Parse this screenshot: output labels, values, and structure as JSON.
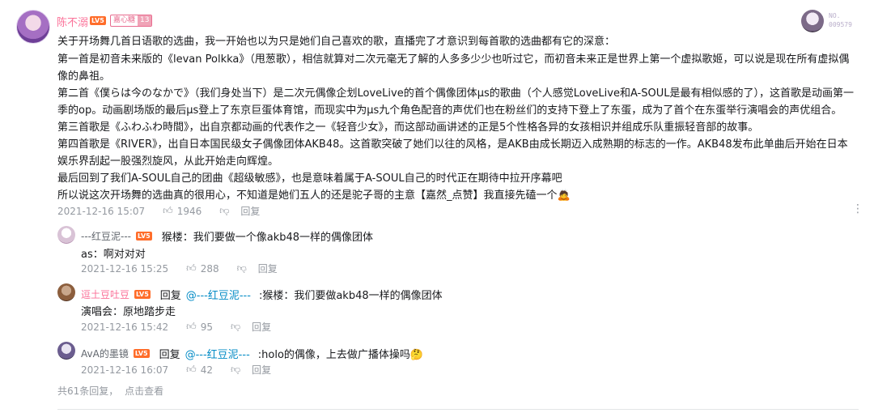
{
  "comment": {
    "username": "陈不溺",
    "level": "LV5",
    "medal_name": "嘉心糖",
    "medal_level": "13",
    "deco_label": "NO.",
    "deco_number": "009579",
    "lines": [
      "关于开场舞几首日语歌的选曲，我一开始也以为只是她们自己喜欢的歌，直播完了才意识到每首歌的选曲都有它的深意：",
      "第一首是初音未来版的《levan Polkka》（甩葱歌），相信就算对二次元毫无了解的人多多少少也听过它，而初音未来正是世界上第一个虚拟歌姬，可以说是现在所有虚拟偶",
      "像的鼻祖。",
      "第二首《僕らは今のなかで》（我们身处当下）是二次元偶像企划LoveLive的首个偶像团体μs的歌曲（个人感觉LoveLive和A-SOUL是最有相似感的了），这首歌是动画第一",
      "季的op。动画剧场版的最后μs登上了东京巨蛋体育馆，而现实中为μs九个角色配音的声优们也在粉丝们的支持下登上了东蛋，成为了首个在东蛋举行演唱会的声优组合。",
      "第三首歌是《ふわふわ時間》，出自京都动画的代表作之一《轻音少女》，而这部动画讲述的正是5个性格各异的女孩相识并组成乐队重振轻音部的故事。",
      "第四首歌是《RIVER》，出自日本国民级女子偶像团体AKB48。这首歌突破了她们以往的风格，是AKB由成长期迈入成熟期的标志的一作。AKB48发布此单曲后开始在日本",
      "娱乐界刮起一股强烈旋风，从此开始走向辉煌。",
      "最后回到了我们A-SOUL自己的团曲《超级敏感》，也是意味着属于A-SOUL自己的时代正在期待中拉开序幕吧",
      "所以说这次开场舞的选曲真的很用心，不知道是她们五人的还是驼子哥的主意【嘉然_点赞】我直接先磕一个🙇"
    ],
    "time": "2021-12-16 15:07",
    "likes": "1946",
    "reply_label": "回复"
  },
  "replies": [
    {
      "username": "---红豆泥---",
      "level": "LV5",
      "prefix": "",
      "mention": "",
      "text1": "猴楼：我们要做一个像akb48一样的偶像团体",
      "text2": "as：啊对对对",
      "time": "2021-12-16 15:25",
      "likes": "288",
      "reply_label": "回复",
      "name_color": "#61666d"
    },
    {
      "username": "逗土豆吐豆",
      "level": "LV5",
      "prefix": "回复",
      "mention": "@---红豆泥---",
      "text1": ":猴楼：我们要做akb48一样的偶像团体",
      "text2": "演唱会：原地踏步走",
      "time": "2021-12-16 15:42",
      "likes": "95",
      "reply_label": "回复",
      "name_color": "#fb7299"
    },
    {
      "username": "AvA的墨镜",
      "level": "LV5",
      "prefix": "回复",
      "mention": "@---红豆泥---",
      "text1": ":holo的偶像，上去做广播体操吗🤔",
      "text2": "",
      "time": "2021-12-16 16:07",
      "likes": "42",
      "reply_label": "回复",
      "name_color": "#61666d"
    }
  ],
  "footer": {
    "count_text": "共61条回复，",
    "view_text": "点击查看"
  },
  "icons": {
    "thumb_up": "thumb-up-icon",
    "thumb_down": "thumb-down-icon",
    "more": "more-vertical-icon"
  }
}
